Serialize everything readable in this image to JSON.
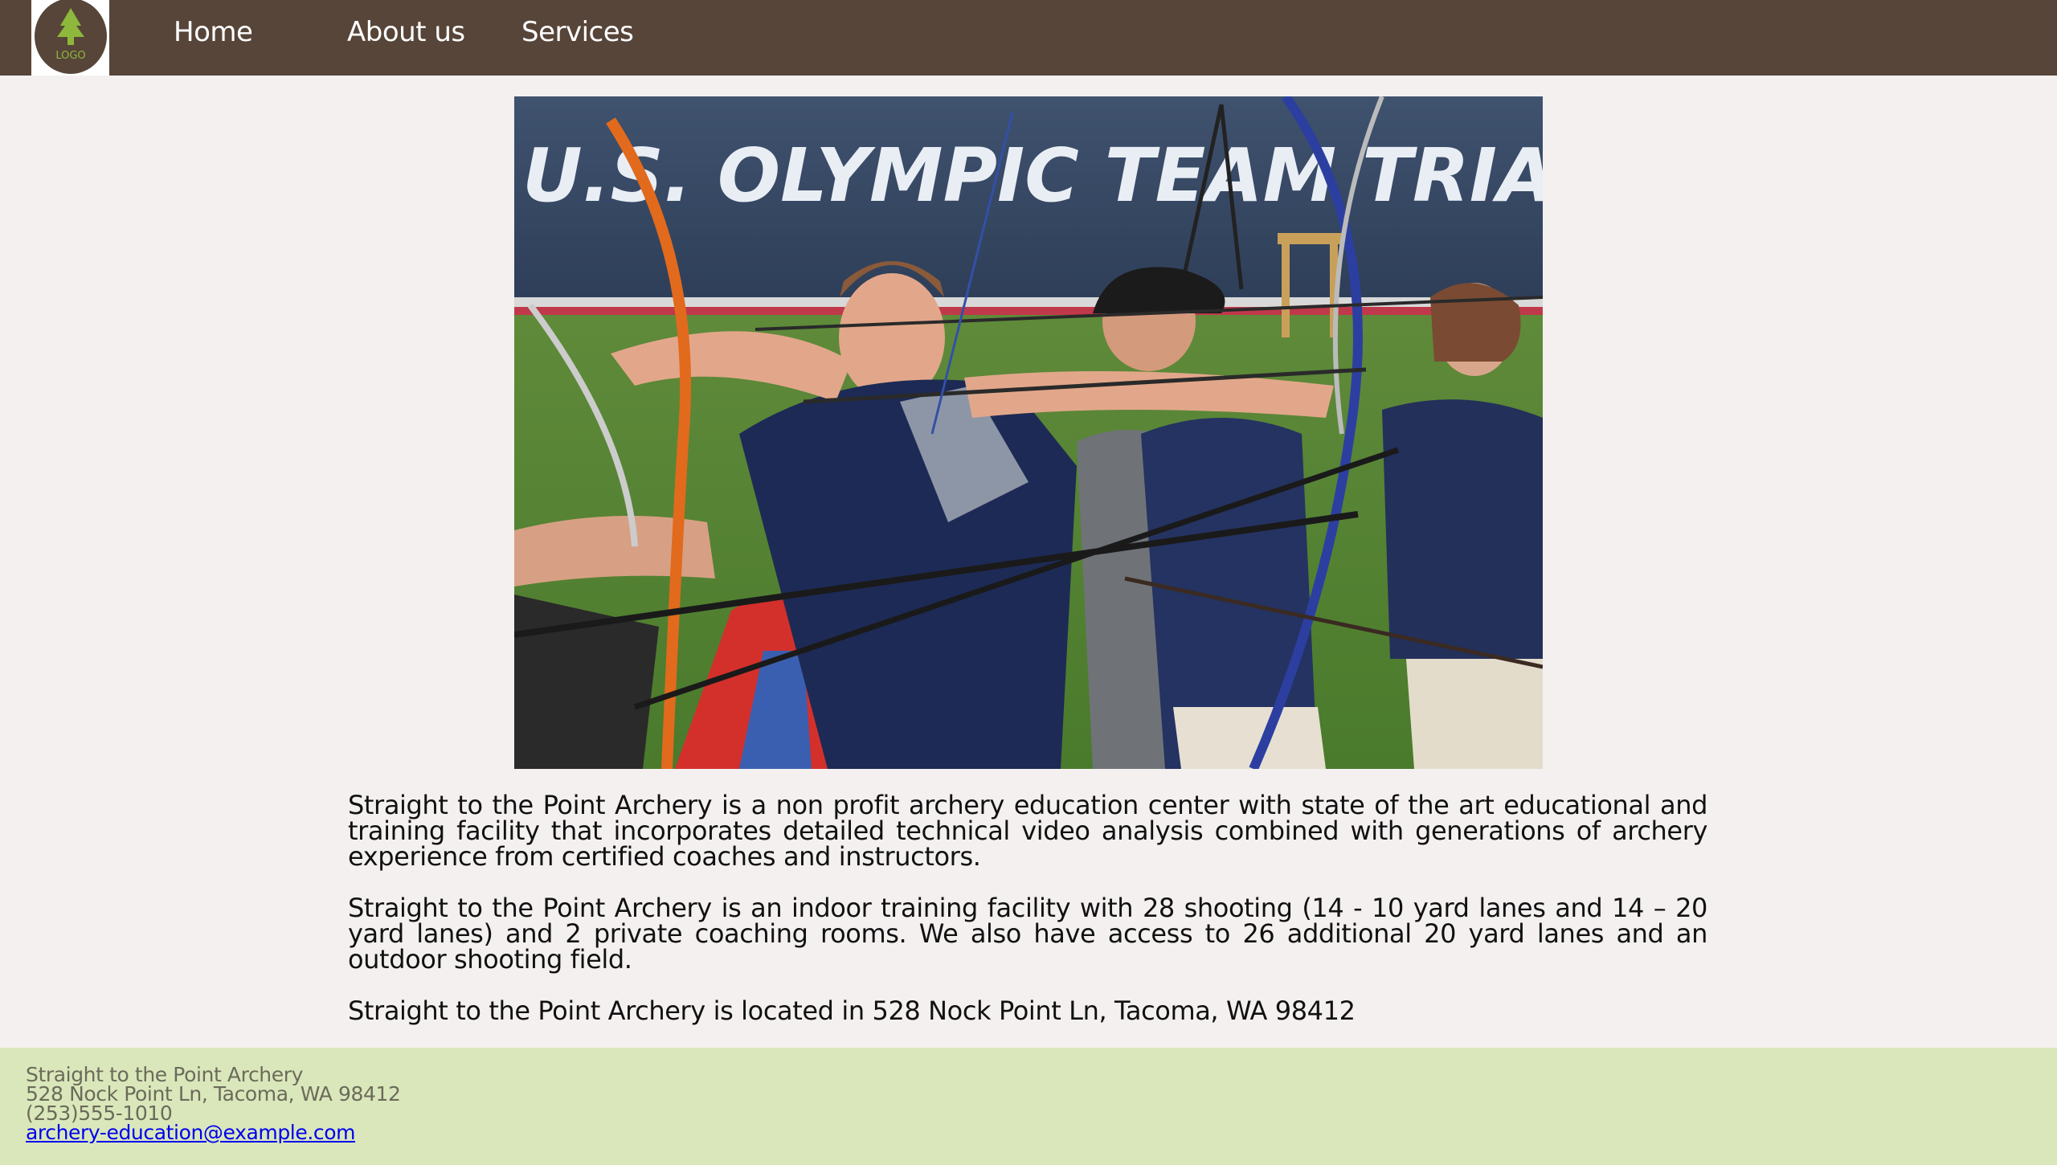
{
  "header": {
    "logo_text": "LOGO",
    "nav": [
      {
        "label": "Home"
      },
      {
        "label": "About us"
      },
      {
        "label": "Services"
      }
    ]
  },
  "hero": {
    "banner_text": "U.S. OLYMPIC TEAM TRIALS"
  },
  "main": {
    "paragraphs": [
      "Straight to the Point Archery is a non profit archery education center with state of the art educational and training facility that incorporates detailed technical video analysis combined with generations of archery experience from certified coaches and instructors.",
      "Straight to the Point Archery is an indoor training facility with  28 shooting (14 -  10 yard lanes and 14 – 20 yard lanes) and 2 private coaching rooms. We also have access to 26  additional  20 yard lanes  and an outdoor shooting field.",
      "Straight to the Point Archery is located in 528 Nock Point Ln, Tacoma, WA 98412"
    ]
  },
  "footer": {
    "name": "Straight to the Point Archery",
    "address": "528 Nock Point Ln, Tacoma, WA 98412",
    "phone": "(253)555-1010",
    "email": "archery-education@example.com"
  },
  "colors": {
    "header_bg": "#574539",
    "page_bg": "#f4f0f0",
    "footer_bg": "#dae7bb",
    "logo_green": "#8db83b",
    "link": "#0000ee"
  }
}
